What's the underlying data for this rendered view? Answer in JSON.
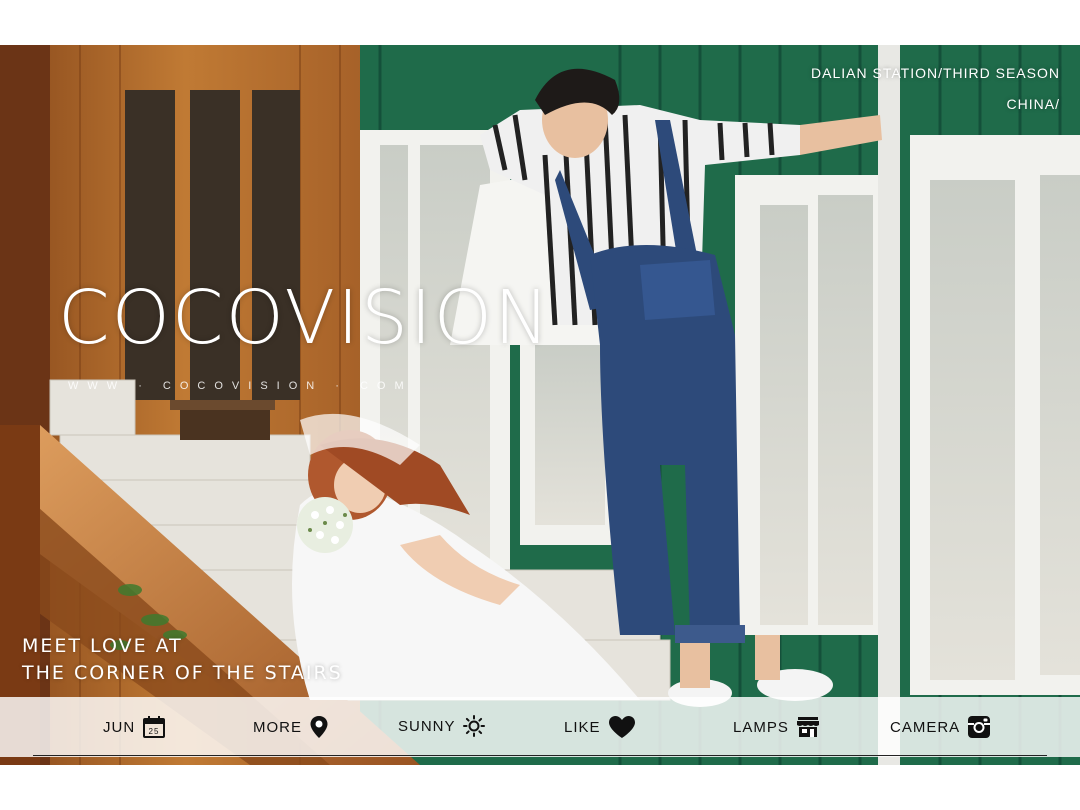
{
  "brand": {
    "logo_text": "COCOVISION",
    "website": "WWW · COCOVISION · COM"
  },
  "header": {
    "line1": "DALIAN STATION/THIRD SEASON",
    "line2": "CHINA/"
  },
  "tagline": {
    "line1": "MEET LOVE AT",
    "line2": "THE CORNER OF THE STAIRS"
  },
  "infobar": {
    "items": [
      {
        "label": "JUN",
        "icon": "calendar-icon",
        "icon_text": "25"
      },
      {
        "label": "MORE",
        "icon": "location-pin-icon"
      },
      {
        "label": "SUNNY",
        "icon": "sun-icon"
      },
      {
        "label": "LIKE",
        "icon": "heart-icon"
      },
      {
        "label": "LAMPS",
        "icon": "storefront-icon"
      },
      {
        "label": "CAMERA",
        "icon": "camera-icon"
      }
    ]
  },
  "colors": {
    "wood": "#b8722e",
    "green_trim": "#1f6b4a",
    "white_frame": "#f2f2ee",
    "denim": "#2d4a7a"
  }
}
